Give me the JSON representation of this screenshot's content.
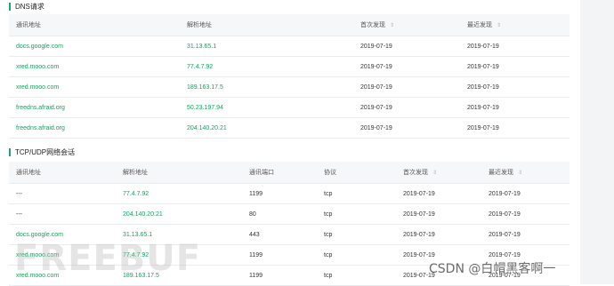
{
  "dns_section": {
    "title": "DNS请求",
    "columns": {
      "comm_addr": "通讯地址",
      "resolved_addr": "解析地址",
      "first_seen": "首次发现",
      "last_seen": "最近发现"
    },
    "rows": [
      {
        "comm_addr": "docs.google.com",
        "resolved_addr": "31.13.65.1",
        "first_seen": "2019-07-19",
        "last_seen": "2019-07-19"
      },
      {
        "comm_addr": "xred.mooo.com",
        "resolved_addr": "77.4.7.92",
        "first_seen": "2019-07-19",
        "last_seen": "2019-07-19"
      },
      {
        "comm_addr": "xred.mooo.com",
        "resolved_addr": "189.163.17.5",
        "first_seen": "2019-07-19",
        "last_seen": "2019-07-19"
      },
      {
        "comm_addr": "freedns.afraid.org",
        "resolved_addr": "50.23.197.94",
        "first_seen": "2019-07-19",
        "last_seen": "2019-07-19"
      },
      {
        "comm_addr": "freedns.afraid.org",
        "resolved_addr": "204.140.20.21",
        "first_seen": "2019-07-19",
        "last_seen": "2019-07-19"
      }
    ]
  },
  "tcp_section": {
    "title": "TCP/UDP网络会话",
    "columns": {
      "comm_addr": "通讯地址",
      "resolved_addr": "解析地址",
      "port": "通讯端口",
      "protocol": "协议",
      "first_seen": "首次发现",
      "last_seen": "最近发现"
    },
    "rows": [
      {
        "comm_addr": "---",
        "resolved_addr": "77.4.7.92",
        "port": "1199",
        "protocol": "tcp",
        "first_seen": "2019-07-19",
        "last_seen": "2019-07-19"
      },
      {
        "comm_addr": "---",
        "resolved_addr": "204.140.20.21",
        "port": "80",
        "protocol": "tcp",
        "first_seen": "2019-07-19",
        "last_seen": "2019-07-19"
      },
      {
        "comm_addr": "docs.google.com",
        "resolved_addr": "31.13.65.1",
        "port": "443",
        "protocol": "tcp",
        "first_seen": "2019-07-19",
        "last_seen": "2019-07-19"
      },
      {
        "comm_addr": "xred.mooo.com",
        "resolved_addr": "77.4.7.92",
        "port": "1199",
        "protocol": "tcp",
        "first_seen": "2019-07-19",
        "last_seen": "2019-07-19"
      },
      {
        "comm_addr": "xred.mooo.com",
        "resolved_addr": "189.163.17.5",
        "port": "1199",
        "protocol": "tcp",
        "first_seen": "2019-07-19",
        "last_seen": "2019-07-19"
      }
    ]
  },
  "watermark": {
    "text": "FREEBUF"
  },
  "csdn_watermark": {
    "text": "CSDN @白帽黑客啊一"
  },
  "colors": {
    "accent": "#1aa57e",
    "link": "#19a15f",
    "header_bg": "#f6f7f9",
    "panel_bg": "#f3f4f6"
  },
  "icons": {
    "sort": "sort-arrows-icon"
  }
}
